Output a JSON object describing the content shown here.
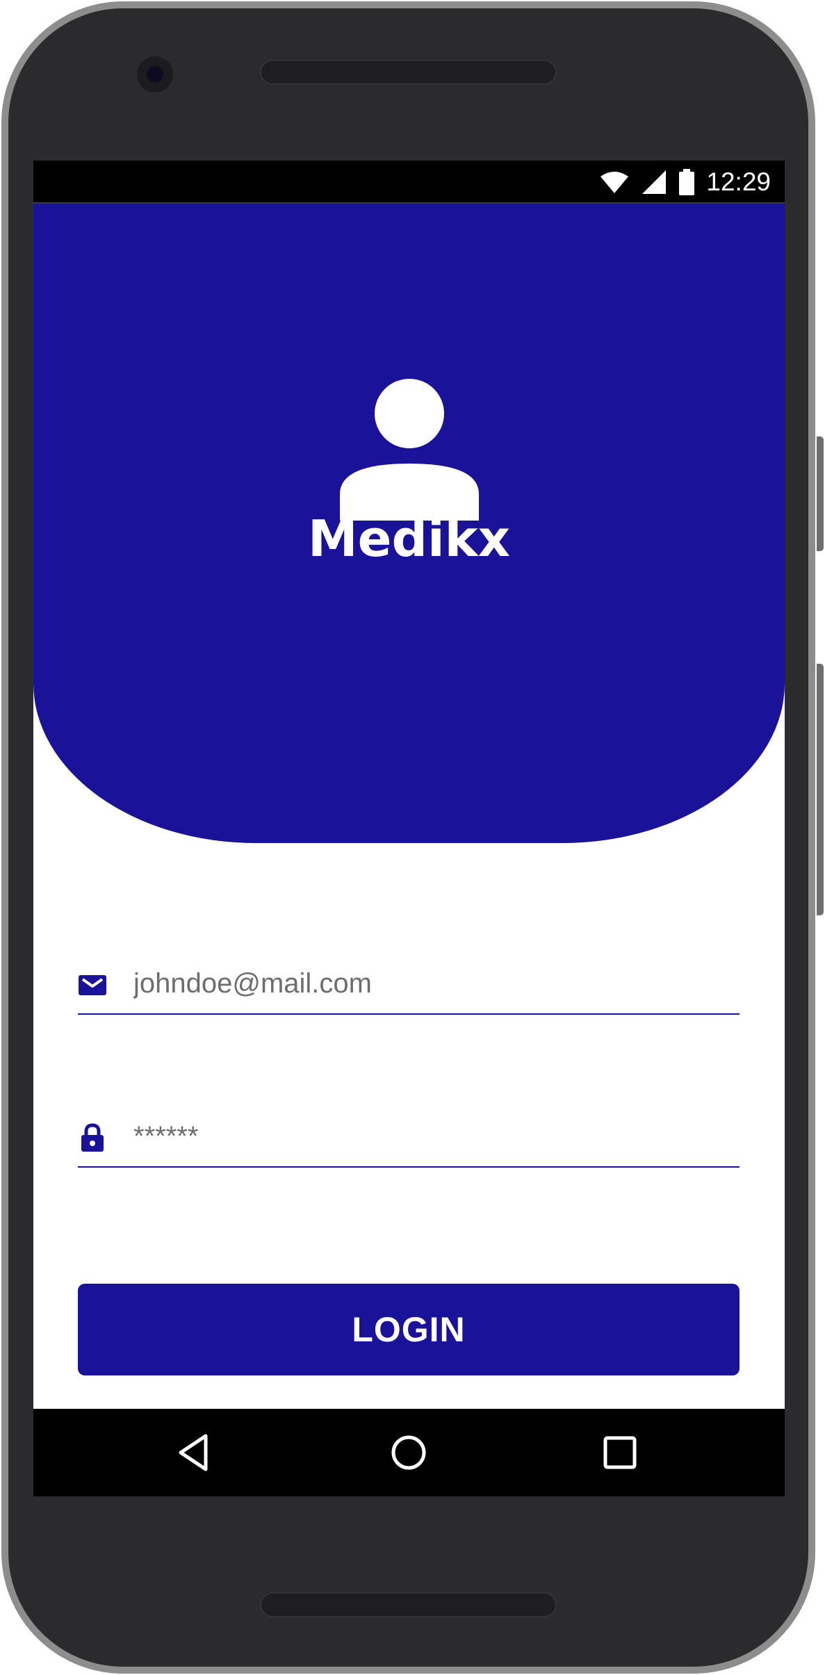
{
  "status_bar": {
    "time": "12:29",
    "icons": [
      "wifi-icon",
      "cellular-signal-icon",
      "battery-icon"
    ]
  },
  "header": {
    "icon": "user-avatar-icon",
    "app_name": "Medikx"
  },
  "form": {
    "email": {
      "icon": "email-icon",
      "placeholder": "johndoe@mail.com",
      "value": ""
    },
    "password": {
      "icon": "lock-icon",
      "placeholder": "******",
      "value": ""
    },
    "login_label": "LOGIN"
  },
  "nav_bar": {
    "buttons": [
      "back-icon",
      "home-icon",
      "recents-icon"
    ]
  },
  "colors": {
    "primary": "#1a1299",
    "text_muted": "#6d6d6d",
    "phone_body": "#2b2a2d",
    "phone_frame": "#8d8d8d"
  }
}
